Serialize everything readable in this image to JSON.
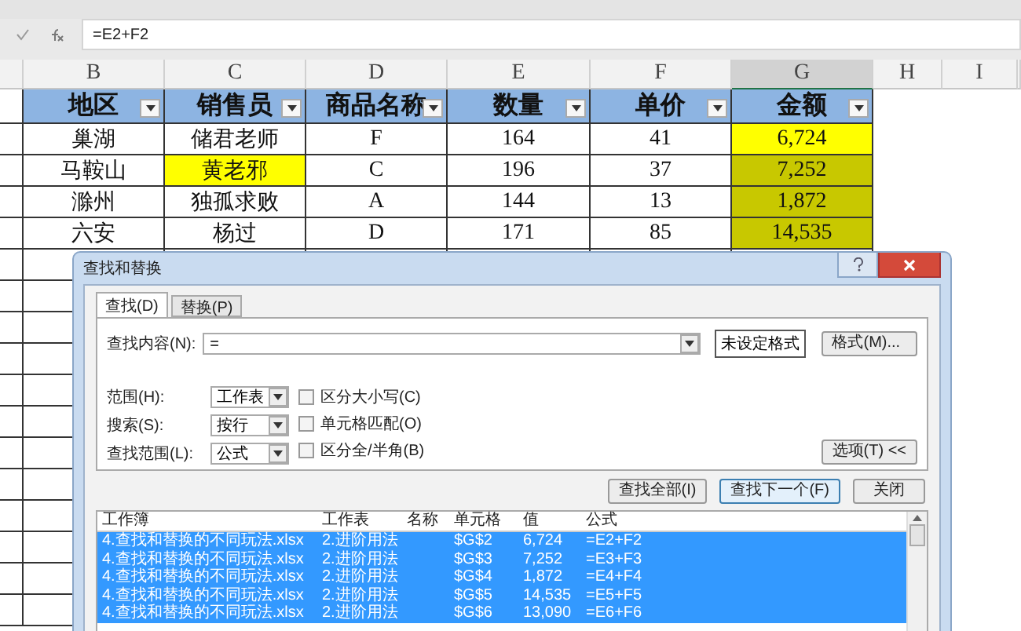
{
  "formula_bar": {
    "formula": "=E2+F2"
  },
  "columns": [
    {
      "letter": "B",
      "selected": false
    },
    {
      "letter": "C",
      "selected": false
    },
    {
      "letter": "D",
      "selected": false
    },
    {
      "letter": "E",
      "selected": false
    },
    {
      "letter": "F",
      "selected": false
    },
    {
      "letter": "G",
      "selected": true
    },
    {
      "letter": "H",
      "selected": false
    },
    {
      "letter": "I",
      "selected": false
    }
  ],
  "table": {
    "headers": [
      "地区",
      "销售员",
      "商品名称",
      "数量",
      "单价",
      "金额"
    ],
    "rows": [
      {
        "cells": [
          {
            "text": "巢湖"
          },
          {
            "text": "储君老师"
          },
          {
            "text": "F"
          },
          {
            "text": "164"
          },
          {
            "text": "41"
          },
          {
            "text": "6,724",
            "color": "#ffff00"
          }
        ]
      },
      {
        "cells": [
          {
            "text": "马鞍山"
          },
          {
            "text": "黄老邪",
            "color": "#ffff00"
          },
          {
            "text": "C"
          },
          {
            "text": "196"
          },
          {
            "text": "37"
          },
          {
            "text": "7,252",
            "color": "#c8c800"
          }
        ]
      },
      {
        "cells": [
          {
            "text": "滁州"
          },
          {
            "text": "独孤求败"
          },
          {
            "text": "A"
          },
          {
            "text": "144"
          },
          {
            "text": "13"
          },
          {
            "text": "1,872",
            "color": "#c8c800"
          }
        ]
      },
      {
        "cells": [
          {
            "text": "六安"
          },
          {
            "text": "杨过"
          },
          {
            "text": "D"
          },
          {
            "text": "171"
          },
          {
            "text": "85"
          },
          {
            "text": "14,535",
            "color": "#c8c800"
          }
        ]
      }
    ]
  },
  "dialog": {
    "title": "查找和替换",
    "tabs": [
      {
        "label": "查找(D)",
        "selected": true
      },
      {
        "label": "替换(P)",
        "selected": false
      }
    ],
    "find_label": "查找内容(N):",
    "find_value": "=",
    "format_preview": "未设定格式",
    "format_button": "格式(M)...",
    "options": [
      {
        "label": "范围(H):",
        "value": "工作表"
      },
      {
        "label": "搜索(S):",
        "value": "按行"
      },
      {
        "label": "查找范围(L):",
        "value": "公式"
      }
    ],
    "checkboxes": [
      {
        "label": "区分大小写(C)",
        "checked": false
      },
      {
        "label": "单元格匹配(O)",
        "checked": false
      },
      {
        "label": "区分全/半角(B)",
        "checked": false
      }
    ],
    "options_button": "选项(T) <<",
    "buttons": [
      {
        "label": "查找全部(I)",
        "selected": false
      },
      {
        "label": "查找下一个(F)",
        "selected": true
      },
      {
        "label": "关闭",
        "selected": false
      }
    ],
    "results": {
      "columns": [
        "工作簿",
        "工作表",
        "名称",
        "单元格",
        "值",
        "公式"
      ],
      "rows": [
        {
          "selected": true,
          "cells": [
            "4.查找和替换的不同玩法.xlsx",
            "2.进阶用法",
            "",
            "$G$2",
            "6,724",
            "=E2+F2"
          ]
        },
        {
          "selected": true,
          "cells": [
            "4.查找和替换的不同玩法.xlsx",
            "2.进阶用法",
            "",
            "$G$3",
            "7,252",
            "=E3+F3"
          ]
        },
        {
          "selected": true,
          "cells": [
            "4.查找和替换的不同玩法.xlsx",
            "2.进阶用法",
            "",
            "$G$4",
            "1,872",
            "=E4+F4"
          ]
        },
        {
          "selected": true,
          "cells": [
            "4.查找和替换的不同玩法.xlsx",
            "2.进阶用法",
            "",
            "$G$5",
            "14,535",
            "=E5+F5"
          ]
        },
        {
          "selected": true,
          "cells": [
            "4.查找和替换的不同玩法.xlsx",
            "2.进阶用法",
            "",
            "$G$6",
            "13,090",
            "=E6+F6"
          ]
        }
      ]
    }
  }
}
